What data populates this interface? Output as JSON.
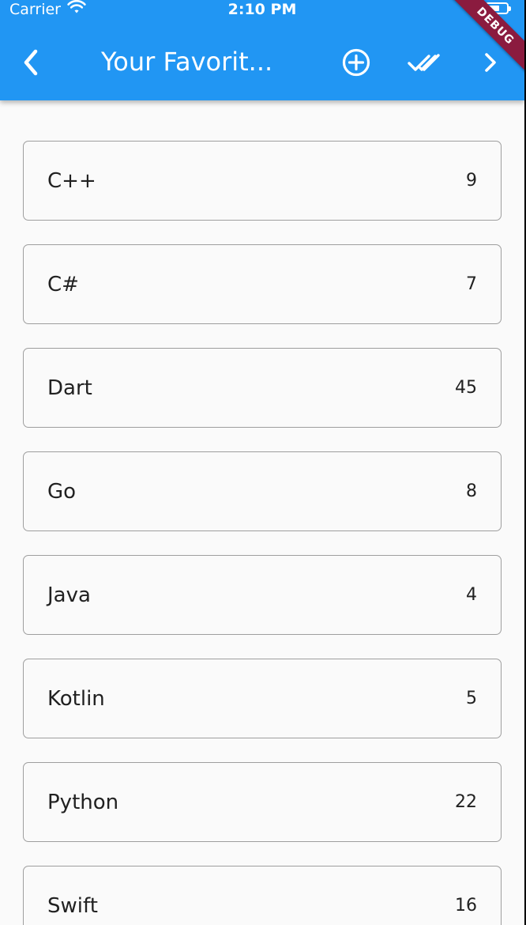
{
  "status_bar": {
    "carrier": "Carrier",
    "time": "2:10 PM",
    "wifi_icon": "wifi-icon",
    "battery_icon": "battery-icon"
  },
  "app_bar": {
    "title": "Your Favorit...",
    "background": "#2196f3",
    "back_icon": "chevron-left-icon",
    "actions": [
      "add-circle-icon",
      "done-all-icon",
      "chevron-right-icon"
    ]
  },
  "debug_banner": "DEBUG",
  "languages": [
    {
      "name": "C++",
      "count": "9"
    },
    {
      "name": "C#",
      "count": "7"
    },
    {
      "name": "Dart",
      "count": "45"
    },
    {
      "name": "Go",
      "count": "8"
    },
    {
      "name": "Java",
      "count": "4"
    },
    {
      "name": "Kotlin",
      "count": "5"
    },
    {
      "name": "Python",
      "count": "22"
    },
    {
      "name": "Swift",
      "count": "16"
    }
  ]
}
